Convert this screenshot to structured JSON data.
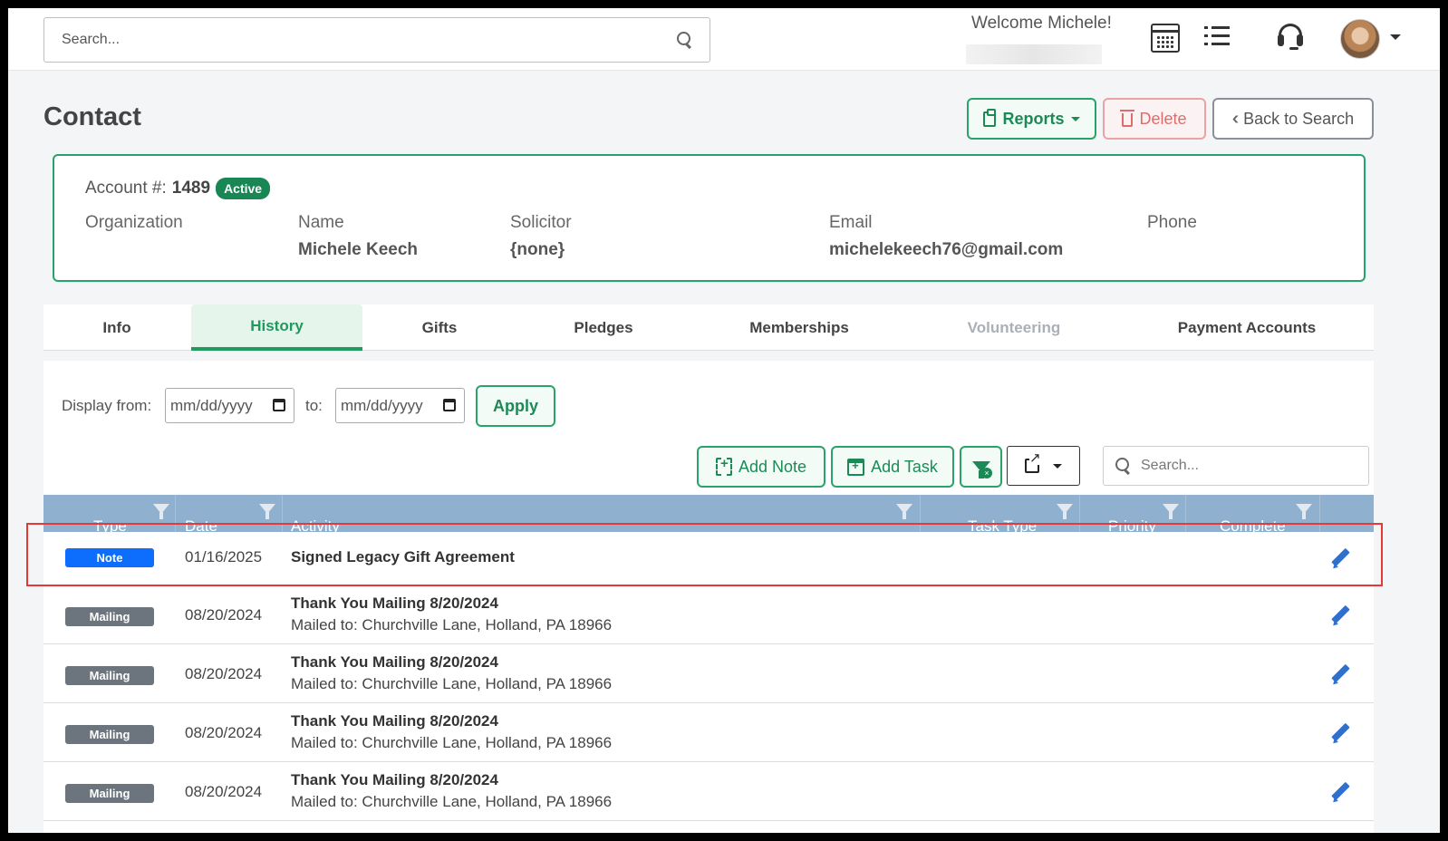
{
  "header": {
    "search_placeholder": "Search...",
    "welcome": "Welcome Michele!",
    "icons": [
      "search-icon",
      "calendar-icon",
      "list-icon",
      "headset-icon",
      "avatar",
      "chevron-down-icon"
    ]
  },
  "page": {
    "title": "Contact",
    "actions": {
      "reports": "Reports",
      "delete": "Delete",
      "back": "Back to Search"
    }
  },
  "contact": {
    "account_label": "Account #:",
    "account_number": "1489",
    "status": "Active",
    "fields": {
      "organization": {
        "label": "Organization",
        "value": ""
      },
      "name": {
        "label": "Name",
        "value": "Michele Keech"
      },
      "solicitor": {
        "label": "Solicitor",
        "value": "{none}"
      },
      "email": {
        "label": "Email",
        "value": "michelekeech76@gmail.com"
      },
      "phone": {
        "label": "Phone",
        "value": ""
      }
    }
  },
  "tabs": [
    {
      "label": "Info",
      "state": "normal"
    },
    {
      "label": "History",
      "state": "active"
    },
    {
      "label": "Gifts",
      "state": "normal"
    },
    {
      "label": "Pledges",
      "state": "normal"
    },
    {
      "label": "Memberships",
      "state": "normal"
    },
    {
      "label": "Volunteering",
      "state": "disabled"
    },
    {
      "label": "Payment Accounts",
      "state": "normal"
    }
  ],
  "history": {
    "display_from_label": "Display from:",
    "to_label": "to:",
    "date_from_placeholder": "mm/dd/yyyy",
    "date_to_placeholder": "mm/dd/yyyy",
    "apply": "Apply",
    "add_note": "Add Note",
    "add_task": "Add Task",
    "table_search_placeholder": "Search...",
    "columns": [
      "Type",
      "Date",
      "Activity",
      "Task Type",
      "Priority",
      "Complete"
    ],
    "rows": [
      {
        "type": "Note",
        "date": "01/16/2025",
        "title": "Signed Legacy Gift Agreement",
        "detail": ""
      },
      {
        "type": "Mailing",
        "date": "08/20/2024",
        "title": "Thank You Mailing 8/20/2024",
        "detail": "Mailed to: Churchville Lane, Holland, PA 18966"
      },
      {
        "type": "Mailing",
        "date": "08/20/2024",
        "title": "Thank You Mailing 8/20/2024",
        "detail": "Mailed to: Churchville Lane, Holland, PA 18966"
      },
      {
        "type": "Mailing",
        "date": "08/20/2024",
        "title": "Thank You Mailing 8/20/2024",
        "detail": "Mailed to: Churchville Lane, Holland, PA 18966"
      },
      {
        "type": "Mailing",
        "date": "08/20/2024",
        "title": "Thank You Mailing 8/20/2024",
        "detail": "Mailed to: Churchville Lane, Holland, PA 18966"
      }
    ]
  },
  "colors": {
    "accent_green": "#1f9a5f",
    "danger": "#e06b6b",
    "note_badge": "#0d6efd",
    "mailing_badge": "#6c757d",
    "table_header": "#8fb1cf",
    "highlight": "#e53935"
  }
}
